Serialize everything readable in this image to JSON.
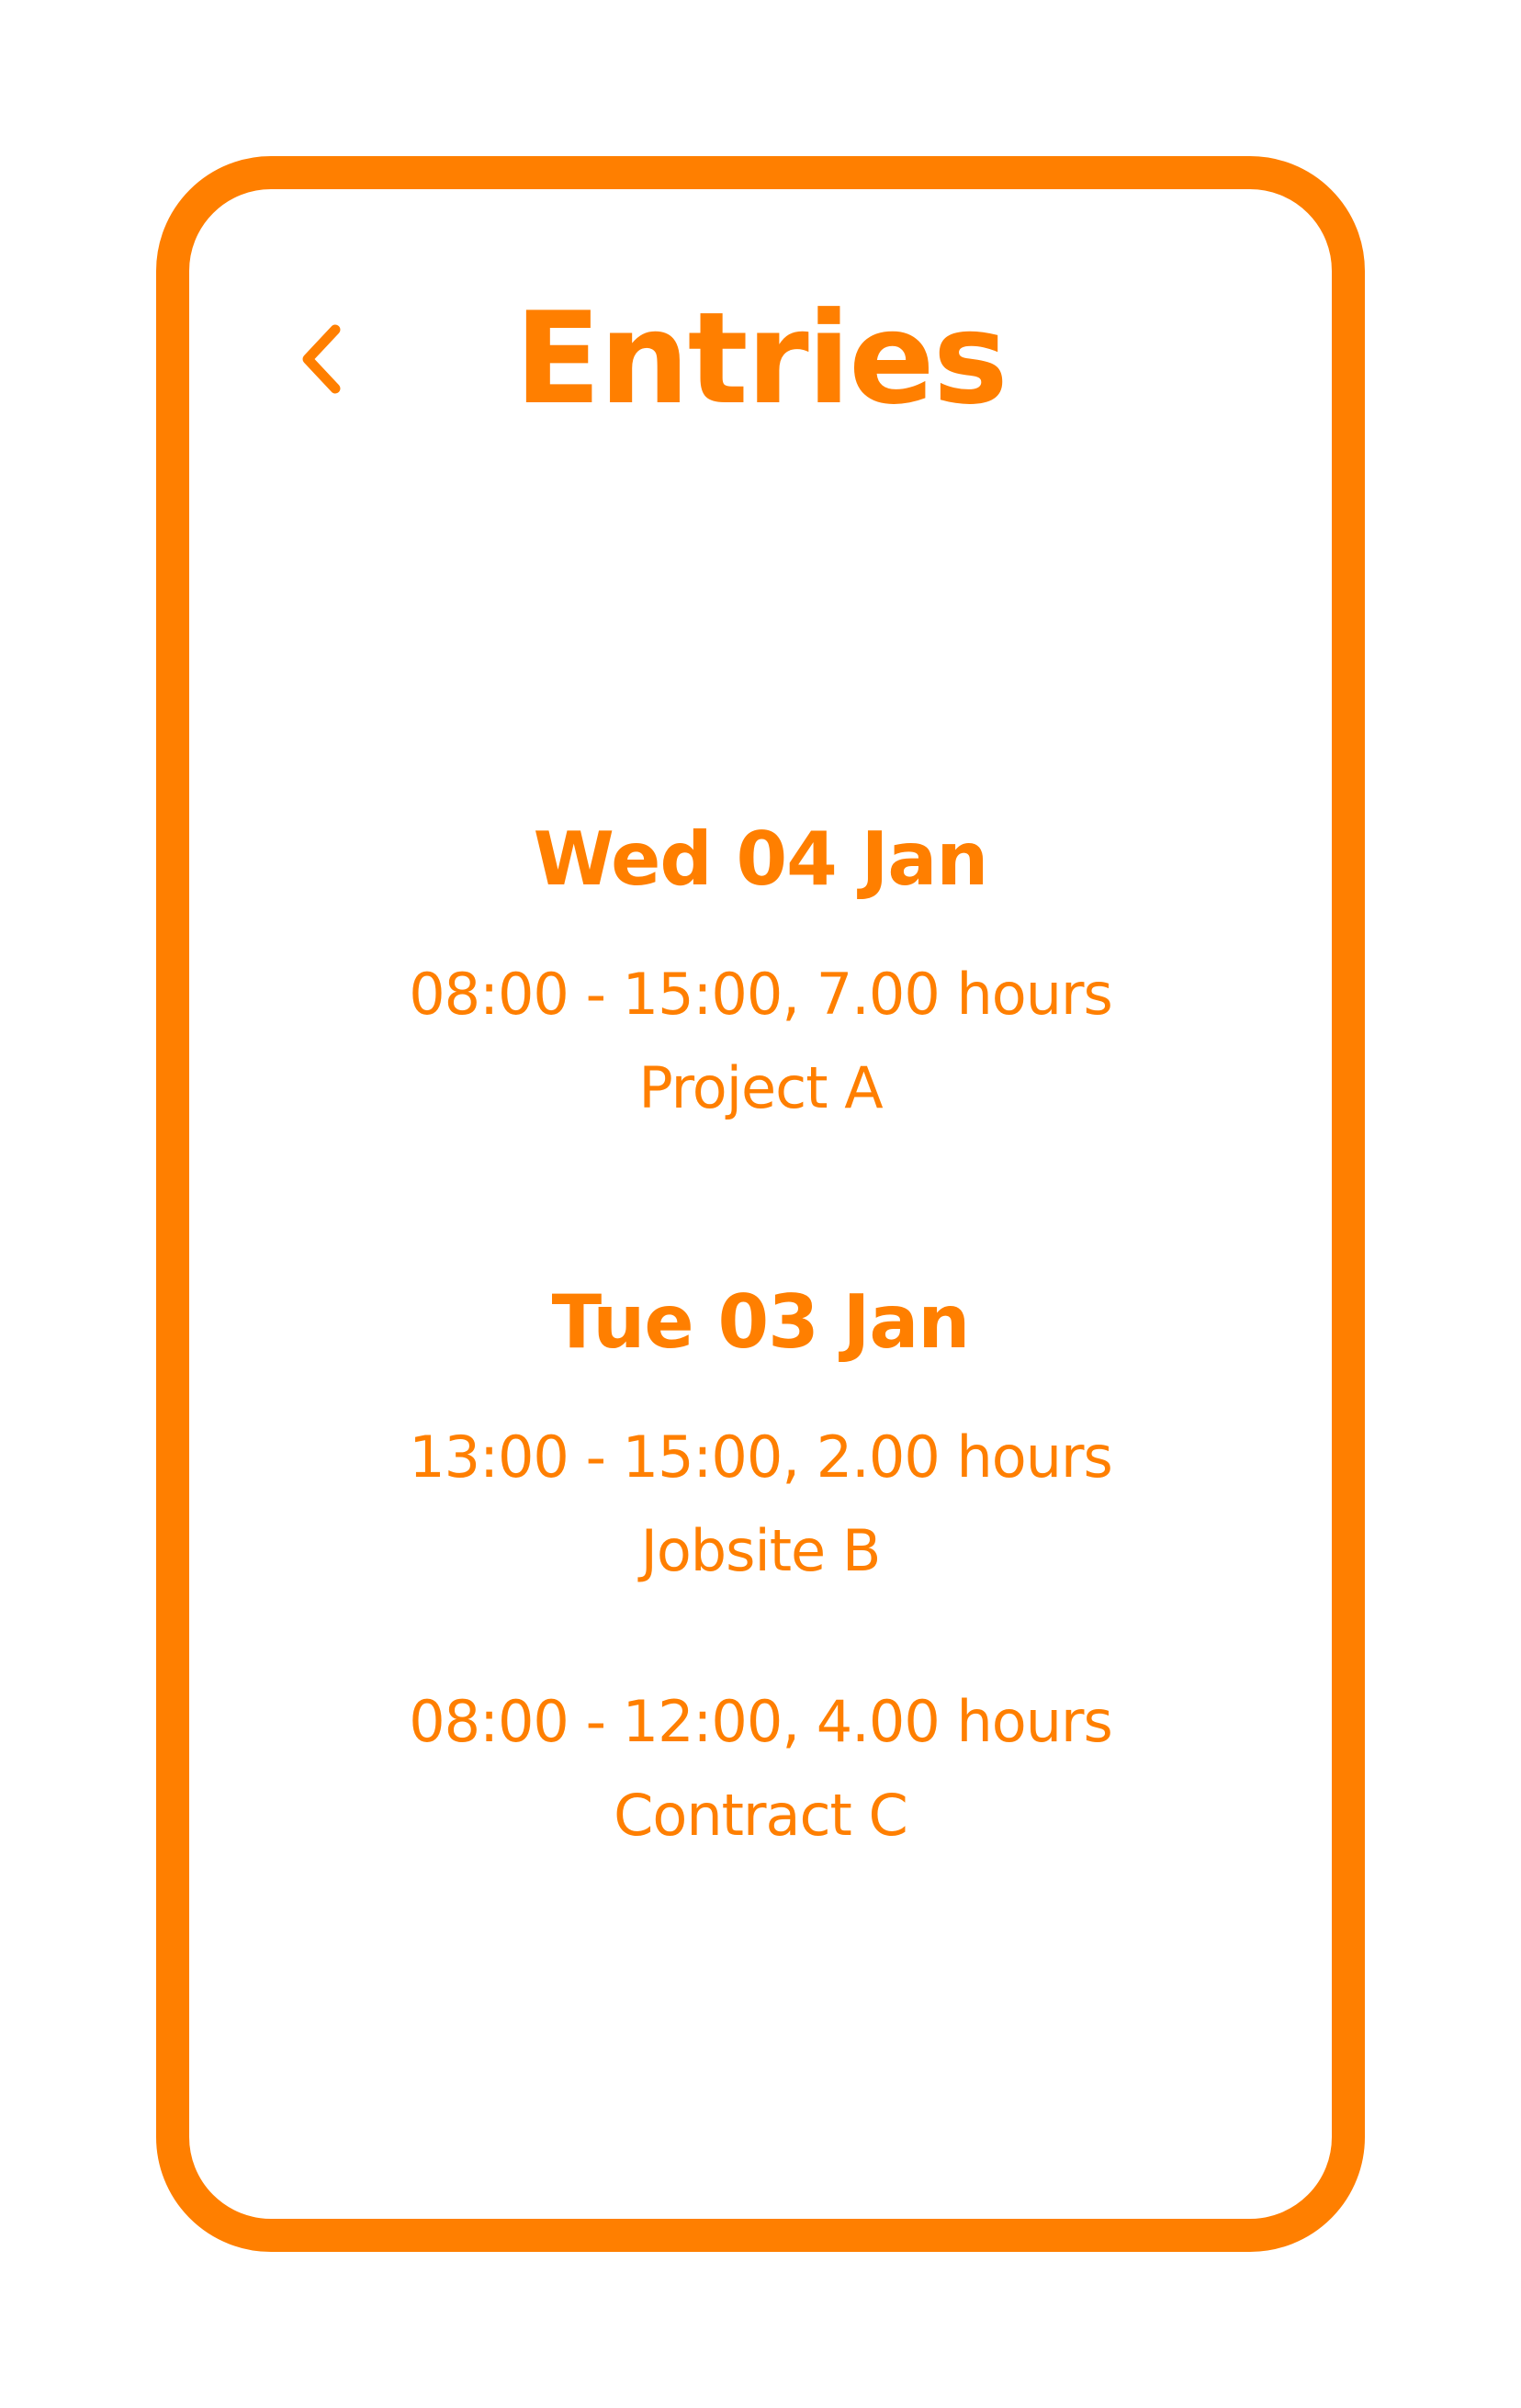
{
  "header": {
    "title": "Entries",
    "back_icon": "chevron-left-icon"
  },
  "colors": {
    "accent": "#ff7f00",
    "background": "#ffffff"
  },
  "days": [
    {
      "label": "Wed 04 Jan",
      "entries": [
        {
          "time": "08:00 - 15:00, 7.00 hours",
          "project": "Project A"
        }
      ]
    },
    {
      "label": "Tue 03 Jan",
      "entries": [
        {
          "time": "13:00 - 15:00, 2.00 hours",
          "project": "Jobsite B"
        },
        {
          "time": "08:00 - 12:00, 4.00 hours",
          "project": "Contract C"
        }
      ]
    }
  ]
}
